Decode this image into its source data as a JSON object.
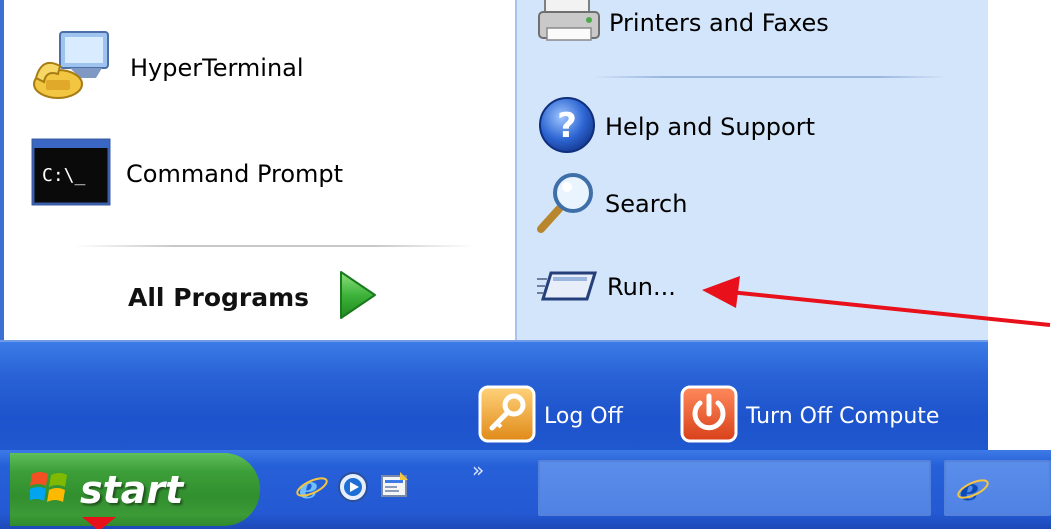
{
  "start_menu": {
    "left_items": [
      {
        "label": "HyperTerminal",
        "icon": "hyperterminal-icon"
      },
      {
        "label": "Command Prompt",
        "icon": "command-prompt-icon",
        "icon_text": "C:\\_"
      }
    ],
    "all_programs_label": "All Programs",
    "right_items": [
      {
        "label": "Printers and Faxes",
        "icon": "printer-icon"
      },
      {
        "label": "Help and Support",
        "icon": "help-icon"
      },
      {
        "label": "Search",
        "icon": "magnifier-icon"
      },
      {
        "label": "Run...",
        "icon": "run-icon"
      }
    ],
    "log_off_label": "Log Off",
    "turn_off_label": "Turn Off Compute"
  },
  "taskbar": {
    "start_label": "start",
    "quick_launch": [
      "internet-explorer-icon",
      "media-player-icon",
      "show-desktop-icon"
    ],
    "chevron": "»"
  },
  "colors": {
    "annotation_arrow": "#e8101a",
    "start_green": "#3d9f39",
    "taskbar_blue": "#2459d3",
    "right_column": "#d3e5fa"
  }
}
